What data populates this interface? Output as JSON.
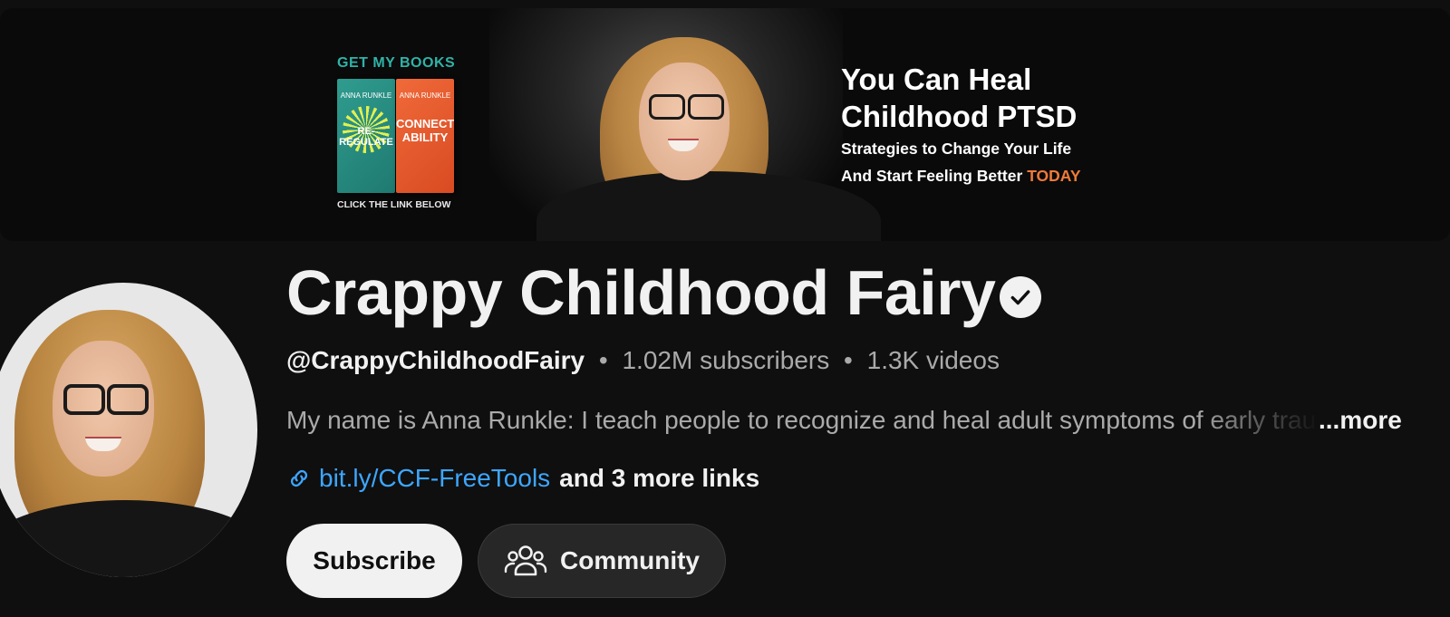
{
  "banner": {
    "books_title": "GET MY BOOKS",
    "book1": {
      "author": "ANNA RUNKLE",
      "title": "RE-REGULATE"
    },
    "book2": {
      "author": "ANNA RUNKLE",
      "title": "CONNECT ABILITY"
    },
    "click_link": "CLICK THE LINK BELOW",
    "headline_line1": "You Can Heal",
    "headline_line2": "Childhood PTSD",
    "subline1": "Strategies to Change Your Life",
    "subline2": "And Start Feeling Better",
    "subline2_highlight": "TODAY",
    "highlight_color": "#f07a3a"
  },
  "channel": {
    "name": "Crappy Childhood Fairy",
    "verified_icon": "verified-check-icon",
    "handle": "@CrappyChildhoodFairy",
    "subscribers": "1.02M subscribers",
    "videos": "1.3K videos",
    "separator": "•",
    "description": "My name is Anna Runkle: I teach people to recognize and heal adult symptoms of early trauma",
    "more_label": "...more",
    "link_icon": "link-icon",
    "link_url": "bit.ly/CCF-FreeTools",
    "more_links": "and 3 more links",
    "link_color": "#3ea6ff"
  },
  "actions": {
    "subscribe_label": "Subscribe",
    "community_label": "Community",
    "community_icon": "people-icon"
  }
}
